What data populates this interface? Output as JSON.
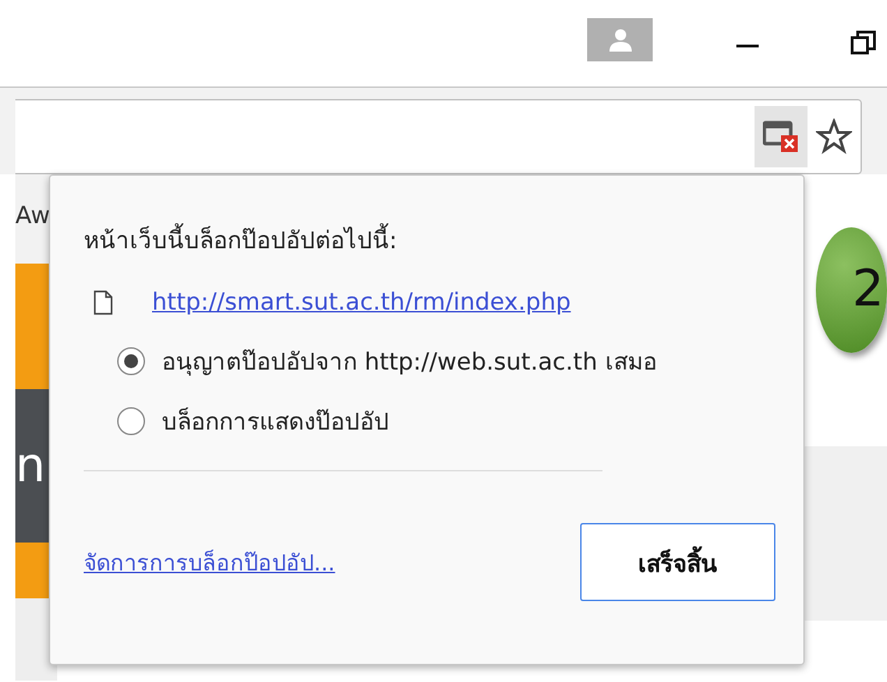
{
  "page": {
    "left_texts": [
      "Aw",
      "n"
    ],
    "step_badge": "2"
  },
  "popup": {
    "title": "หน้าเว็บนี้บล็อกป๊อปอัปต่อไปนี้:",
    "blocked": [
      {
        "url": "http://smart.sut.ac.th/rm/index.php"
      }
    ],
    "options": [
      {
        "label": "อนุญาตป๊อปอัปจาก http://web.sut.ac.th เสมอ",
        "selected": true
      },
      {
        "label": "บล็อกการแสดงป๊อปอัป",
        "selected": false
      }
    ],
    "manage_link": "จัดการการบล็อกป๊อปอัป...",
    "done_button": "เสร็จสิ้น"
  }
}
